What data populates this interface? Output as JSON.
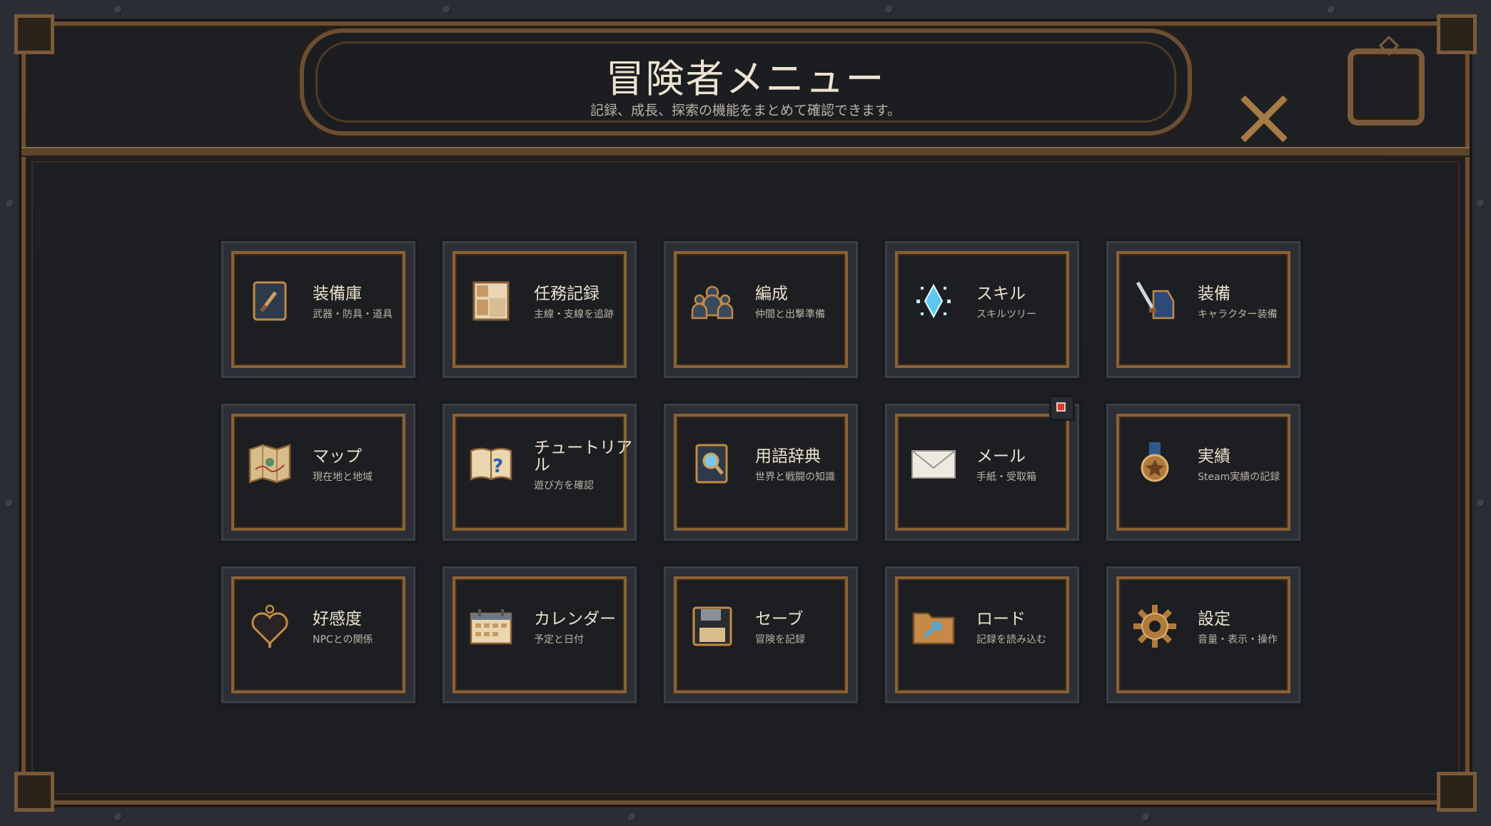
{
  "header": {
    "title": "冒険者メニュー",
    "subtitle": "記録、成長、探索の機能をまとめて確認できます。"
  },
  "controls": {
    "close_icon": "close-icon",
    "window_icon": "square-window-icon"
  },
  "menu": [
    {
      "label": "装備庫",
      "sub": "武器・防具・道具",
      "icon": "armory-book-icon"
    },
    {
      "label": "任務記録",
      "sub": "主線・支線を追跡",
      "icon": "quest-log-icon"
    },
    {
      "label": "編成",
      "sub": "仲間と出撃準備",
      "icon": "party-icon"
    },
    {
      "label": "スキル",
      "sub": "スキルツリー",
      "icon": "skill-crystal-icon"
    },
    {
      "label": "装備",
      "sub": "キャラクター装備",
      "icon": "equipment-icon"
    },
    {
      "label": "マップ",
      "sub": "現在地と地域",
      "icon": "map-icon"
    },
    {
      "label": "チュートリアル",
      "sub": "遊び方を確認",
      "icon": "tutorial-book-icon"
    },
    {
      "label": "用語辞典",
      "sub": "世界と戦闘の知識",
      "icon": "glossary-book-icon"
    },
    {
      "label": "メール",
      "sub": "手紙・受取箱",
      "icon": "mail-icon",
      "badge": true
    },
    {
      "label": "実績",
      "sub": "Steam実績の記録",
      "icon": "medal-icon"
    },
    {
      "label": "好感度",
      "sub": "NPCとの関係",
      "icon": "heart-icon"
    },
    {
      "label": "カレンダー",
      "sub": "予定と日付",
      "icon": "calendar-icon"
    },
    {
      "label": "セーブ",
      "sub": "冒険を記録",
      "icon": "save-disk-icon"
    },
    {
      "label": "ロード",
      "sub": "記録を読み込む",
      "icon": "load-folder-icon"
    },
    {
      "label": "設定",
      "sub": "音量・表示・操作",
      "icon": "gear-icon"
    }
  ],
  "colors": {
    "accent": "#8a6136",
    "text": "#e9e1cc",
    "badge": "#d93a2e"
  }
}
